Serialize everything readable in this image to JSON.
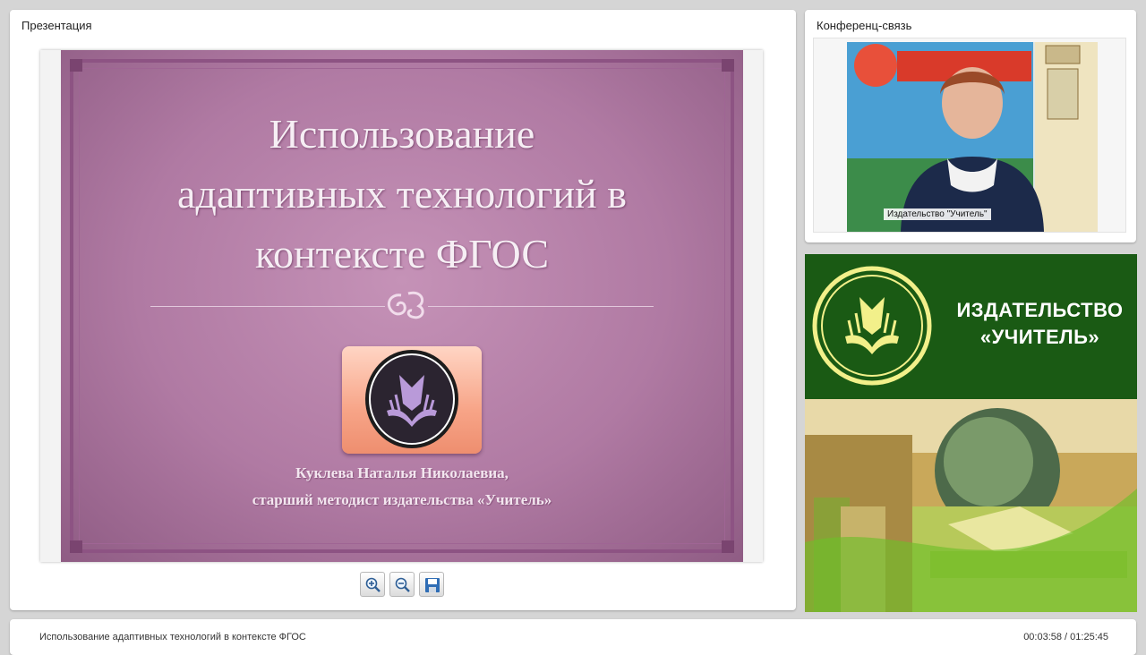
{
  "presentation_panel": {
    "title": "Презентация",
    "slide": {
      "title": "Использование\nадаптивных технологий в\nконтексте ФГОС",
      "author_name": "Куклева Наталья Николаевиа,",
      "author_role": "старший методист издательства «Учитель»"
    },
    "toolbar": {
      "zoom_in_icon": "zoom-in-icon",
      "zoom_out_icon": "zoom-out-icon",
      "save_icon": "save-icon"
    }
  },
  "conference_panel": {
    "title": "Конференц-связь",
    "video_label": "Издательство \"Учитель\""
  },
  "banner": {
    "text": "ИЗДАТЕЛЬСТВО\n«УЧИТЕЛЬ»"
  },
  "bottom_bar": {
    "title": "Использование адаптивных технологий в контексте ФГОС",
    "time": "00:03:58 / 01:25:45"
  },
  "colors": {
    "slide_bg": "#b07aa3",
    "banner_green": "#1a5a14",
    "accent_logo": "#f7a487"
  }
}
